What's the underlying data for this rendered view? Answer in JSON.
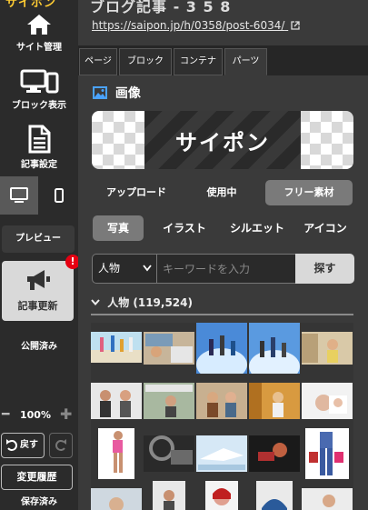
{
  "sidebar": {
    "logo": "サイポン",
    "nav": [
      {
        "label": "サイト管理",
        "icon": "home-icon"
      },
      {
        "label": "ブロック表示",
        "icon": "monitor-icon"
      },
      {
        "label": "記事設定",
        "icon": "document-icon"
      }
    ],
    "device_tabs": [
      {
        "icon": "desktop-icon",
        "active": true
      },
      {
        "icon": "smartphone-icon",
        "active": false
      }
    ],
    "preview_label": "プレビュー",
    "update_label": "記事更新",
    "update_badge": "!",
    "publish_status": "公開済み",
    "zoom": {
      "value": "100%",
      "minus": "━",
      "plus": "✚"
    },
    "undo_label": "戻す",
    "history_label": "変更履歴",
    "save_status": "保存済み"
  },
  "header": {
    "title": "ブログ記事 - 3 5 8",
    "url": "https://saipon.jp/h/0358/post-6034/"
  },
  "tabs": [
    {
      "label": "ページ",
      "active": false
    },
    {
      "label": "ブロック",
      "active": false
    },
    {
      "label": "コンテナ",
      "active": false
    },
    {
      "label": "パーツ",
      "active": true
    }
  ],
  "panel": {
    "section_title": "画像",
    "preview_logo_text": "サイポン",
    "sources": [
      {
        "label": "アップロード",
        "active": false
      },
      {
        "label": "使用中",
        "active": false
      },
      {
        "label": "フリー素材",
        "active": true
      }
    ],
    "types": [
      {
        "label": "写真",
        "active": true
      },
      {
        "label": "イラスト",
        "active": false
      },
      {
        "label": "シルエット",
        "active": false
      },
      {
        "label": "アイコン",
        "active": false
      }
    ],
    "search": {
      "category_selected": "人物",
      "placeholder": "キーワードを入力",
      "value": "",
      "button_label": "探す"
    },
    "category_heading": "人物 (119,524)"
  },
  "colors": {
    "sidebar_bg": "#2b2b2b",
    "panel_bg": "#3a3a3a",
    "active_tab": "#595959",
    "toggle_active": "#7a7a7a",
    "badge": "#e60012",
    "button_light": "#d9d9d9"
  }
}
